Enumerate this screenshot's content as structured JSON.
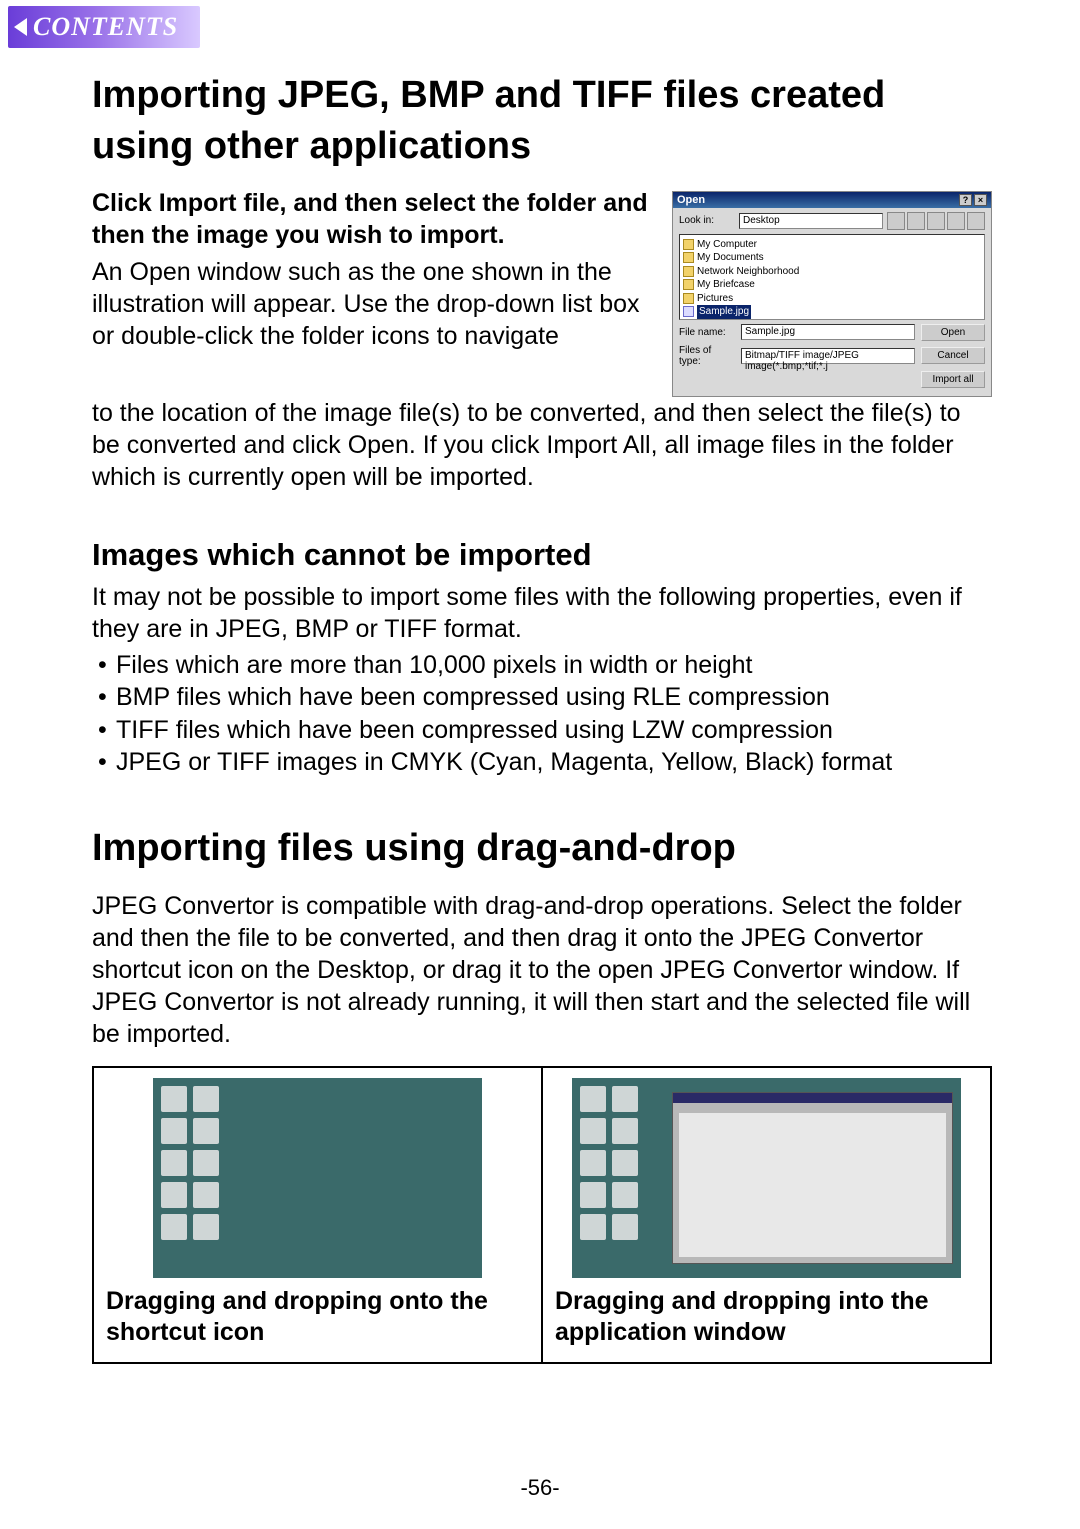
{
  "contents_tab": "CONTENTS",
  "h1": "Importing JPEG, BMP and TIFF files created using other applications",
  "lead": "Click Import file, and then select the folder and then the image you wish to import.",
  "body1": "An Open window such as the one shown in the illustration will appear. Use the drop-down list box or double-click the folder icons to navigate to the location of the image file(s) to be converted, and then select the file(s) to be converted and click Open. If you click Import All, all image files in the folder which is currently open will be imported.",
  "h2a": "Images which cannot be imported",
  "body2": "It may not be possible to import some files with the following properties, even if they are in JPEG, BMP or TIFF format.",
  "bullets": [
    "Files which are more than 10,000 pixels in width or height",
    "BMP files which have been compressed using RLE compression",
    "TIFF files which have been compressed using LZW compression",
    "JPEG or TIFF images in CMYK (Cyan, Magenta, Yellow, Black) format"
  ],
  "h1b": "Importing files using drag-and-drop",
  "body3": "JPEG Convertor is compatible with drag-and-drop operations. Select the folder and then the file to be converted, and then drag it onto the JPEG Convertor shortcut icon on the Desktop, or drag it to the open JPEG Convertor window. If JPEG Convertor is not already running, it will then start and the selected file will be imported.",
  "dnd": {
    "left_caption": "Dragging and dropping onto the shortcut icon",
    "right_caption": "Dragging and dropping into the application window"
  },
  "pagenum": "-56-",
  "open_dialog": {
    "title": "Open",
    "lookin_label": "Look in:",
    "lookin_value": "Desktop",
    "items": [
      "My Computer",
      "My Documents",
      "Network Neighborhood",
      "My Briefcase",
      "Pictures"
    ],
    "selected_item": "Sample.jpg",
    "filename_label": "File name:",
    "filename_value": "Sample.jpg",
    "filetype_label": "Files of type:",
    "filetype_value": "Bitmap/TIFF image/JPEG image(*.bmp;*tif;*.j",
    "btn_open": "Open",
    "btn_cancel": "Cancel",
    "btn_importall": "Import all"
  }
}
